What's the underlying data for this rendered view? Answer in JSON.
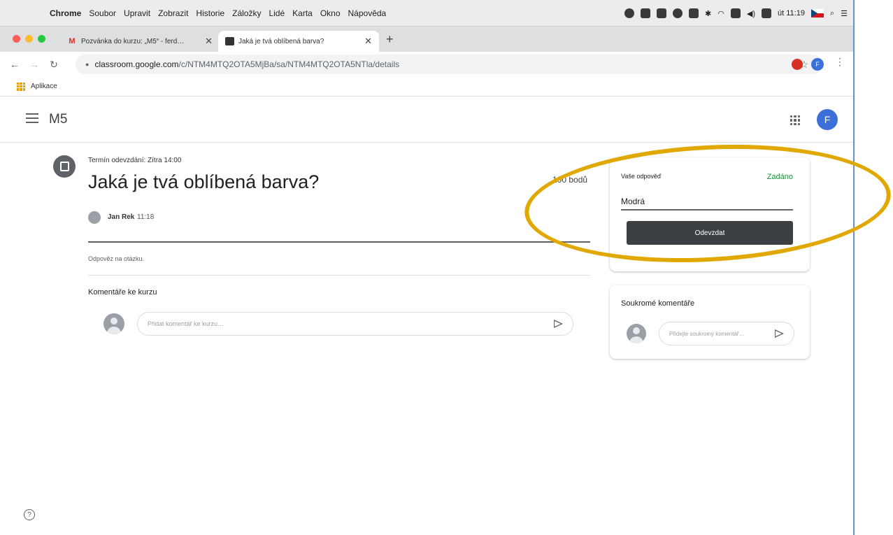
{
  "menubar": {
    "app": "Chrome",
    "items": [
      "Soubor",
      "Upravit",
      "Zobrazit",
      "Historie",
      "Záložky",
      "Lidé",
      "Karta",
      "Okno",
      "Nápověda"
    ],
    "clock": "út 11:19"
  },
  "tabs": [
    {
      "title": "Pozvánka do kurzu: „M5“ - ferd…",
      "icon": "gmail-icon"
    },
    {
      "title": "Jaká je tvá oblíbená barva?",
      "icon": "classroom-icon"
    }
  ],
  "address": {
    "domain": "classroom.google.com",
    "path": "/c/NTM4MTQ2OTA5MjBa/sa/NTM4MTQ2OTA5NTla/details"
  },
  "bookmarks": {
    "apps_label": "Aplikace"
  },
  "classroom": {
    "class_name": "M5",
    "avatar_letter": "F"
  },
  "assignment": {
    "due": "Termín odevzdání: Zítra 14:00",
    "title": "Jaká je tvá oblíbená barva?",
    "points": "100 bodů",
    "author": "Jan Rek",
    "time": "11:18",
    "instructions": "Odpověz na otázku.",
    "comments_title": "Komentáře ke kurzu",
    "comment_placeholder": "Přidat komentář ke kurzu…"
  },
  "your_work": {
    "label": "Vaše odpověď",
    "status": "Zadáno",
    "answer": "Modrá",
    "submit_label": "Odevzdat"
  },
  "private_comments": {
    "title": "Soukromé komentáře",
    "placeholder": "Přidejte soukromý komentář…"
  },
  "colors": {
    "highlight": "#e0a800",
    "status_green": "#1e8e3e",
    "accent_blue": "#3c6fd8"
  }
}
